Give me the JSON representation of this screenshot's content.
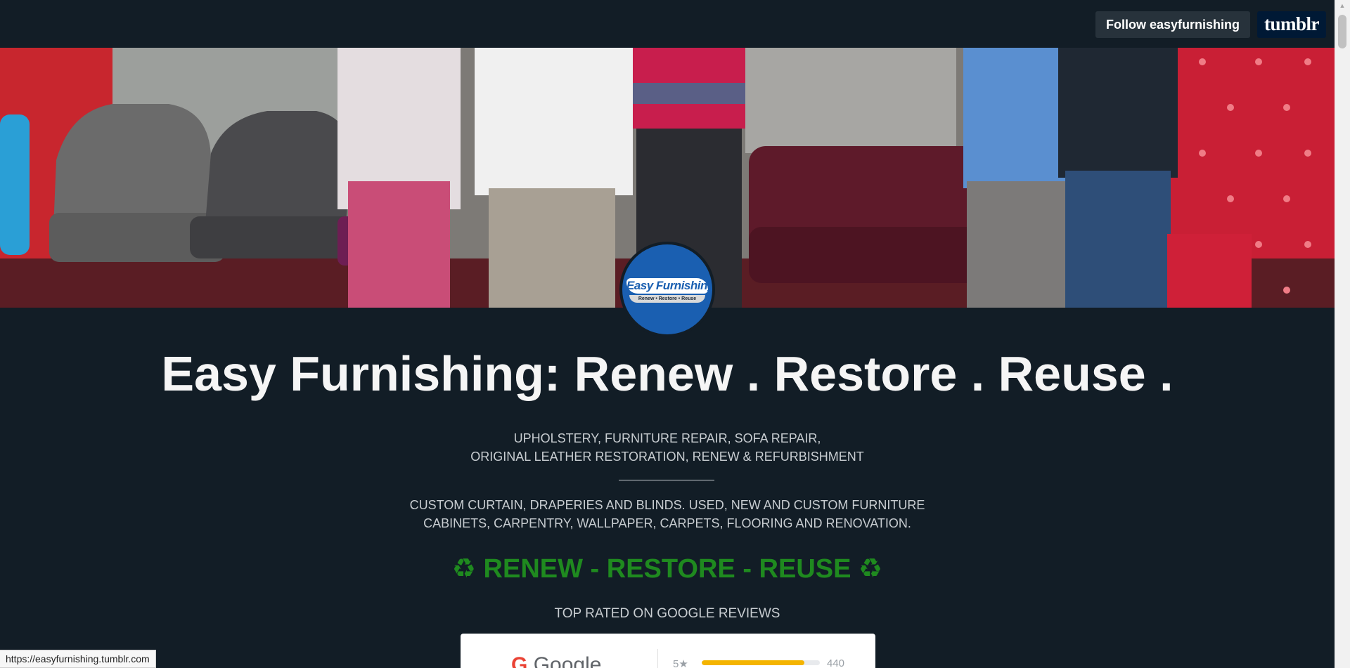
{
  "topbar": {
    "follow_label": "Follow easyfurnishing",
    "brand_logo": "tumblr"
  },
  "avatar": {
    "logo_text": "Easy Furnishing",
    "logo_tagline": "Renew • Restore • Reuse"
  },
  "blog": {
    "title": "Easy Furnishing: Renew . Restore . Reuse .",
    "description_1_line_1": "UPHOLSTERY, FURNITURE REPAIR, SOFA REPAIR,",
    "description_1_line_2": "ORIGINAL LEATHER RESTORATION, RENEW & REFURBISHMENT",
    "description_2_line_1": "CUSTOM CURTAIN, DRAPERIES AND BLINDS. USED, NEW AND CUSTOM FURNITURE",
    "description_2_line_2": "CABINETS, CARPENTRY, WALLPAPER, CARPETS, FLOORING AND RENOVATION.",
    "slogan": "♻ RENEW - RESTORE - REUSE ♻",
    "reviews_heading": "TOP RATED ON GOOGLE REVIEWS"
  },
  "reviews_card": {
    "google_label": "Google",
    "star_label": "5★",
    "rating_count": "440",
    "rating_fill_fraction": 0.87
  },
  "status_bar": {
    "url": "https://easyfurnishing.tumblr.com"
  },
  "colors": {
    "page_background": "#121d26",
    "slogan_green": "#1f8a1f",
    "avatar_blue": "#1a5fb1",
    "tumblr_navy": "#001935"
  }
}
